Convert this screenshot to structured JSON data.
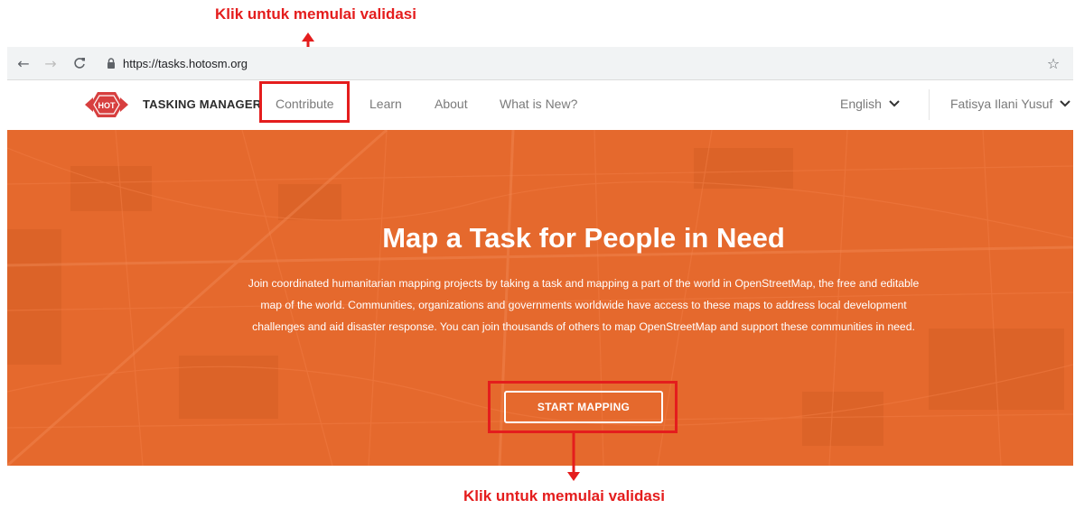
{
  "annotations": {
    "top": "Klik untuk memulai validasi",
    "bottom": "Klik untuk memulai validasi",
    "color": "#e41d1d"
  },
  "browser": {
    "url": "https://tasks.hotosm.org",
    "icons": [
      "back-arrow-icon",
      "forward-arrow-icon",
      "reload-icon",
      "lock-icon",
      "star-icon"
    ]
  },
  "header": {
    "logo_text": "HOT",
    "brand": "TASKING MANAGER",
    "nav": [
      "Contribute",
      "Learn",
      "About",
      "What is New?"
    ],
    "language": "English",
    "user": "Fatisya Ilani Yusuf"
  },
  "hero": {
    "title": "Map a Task for People in Need",
    "description": "Join coordinated humanitarian mapping projects by taking a task and mapping a part of the world in OpenStreetMap, the free and editable map of the world. Communities, organizations and governments worldwide have access to these maps to address local development challenges and aid disaster response. You can join thousands of others to map OpenStreetMap and support these communities in need.",
    "button": "START MAPPING",
    "background_color": "#e5692d"
  }
}
